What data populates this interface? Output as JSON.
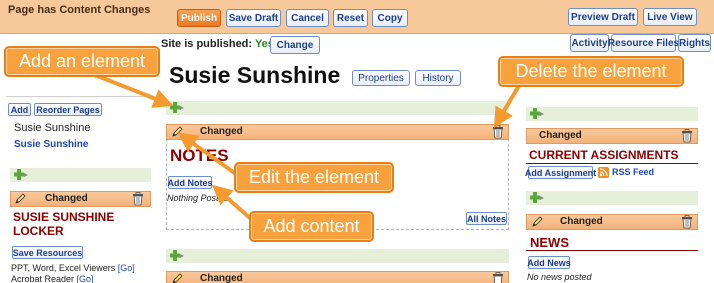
{
  "app": {
    "page_title": "Page has Content Changes"
  },
  "toolbar": {
    "publish": "Publish",
    "save_draft": "Save Draft",
    "cancel": "Cancel",
    "reset": "Reset",
    "copy": "Copy",
    "preview_draft": "Preview Draft",
    "live_view": "Live View"
  },
  "subbar": {
    "status_label": "Site is published:",
    "status_value": "Yes",
    "change": "Change",
    "activity": "Activity",
    "resource_files": "Resource Files",
    "rights": "Rights"
  },
  "header": {
    "title": "Susie Sunshine",
    "properties": "Properties",
    "history": "History"
  },
  "left": {
    "add": "Add",
    "reorder": "Reorder Pages",
    "page_name": "Susie Sunshine",
    "page_link": "Susie Sunshine",
    "element_status": "Changed",
    "element_title": "SUSIE SUNSHINE LOCKER",
    "save_resources": "Save Resources",
    "line1_text": "PPT, Word, Excel Viewers ",
    "line1_link": "[Go]",
    "line2_text": "Acrobat Reader ",
    "line2_link": "[Go]"
  },
  "middle": {
    "element_status": "Changed",
    "element_title": "NOTES",
    "add_notes": "Add Notes",
    "nothing_posted": "Nothing Posted",
    "all_notes": "All Notes",
    "element2_status": "Changed"
  },
  "right": {
    "element1_status": "Changed",
    "element1_title": "CURRENT ASSIGNMENTS",
    "add_assignment": "Add Assignment",
    "rss_feed": "RSS Feed",
    "element2_status": "Changed",
    "element2_title": "NEWS",
    "add_news": "Add News",
    "no_news": "No news posted"
  },
  "callouts": {
    "add_element": "Add an element",
    "delete_element": "Delete the element",
    "edit_element": "Edit the element",
    "add_content": "Add content"
  },
  "colors": {
    "callout": "#f9a13c",
    "toolbar": "#f7c89a",
    "accent_orange": "#e97a21",
    "title_red": "#8b0000"
  }
}
